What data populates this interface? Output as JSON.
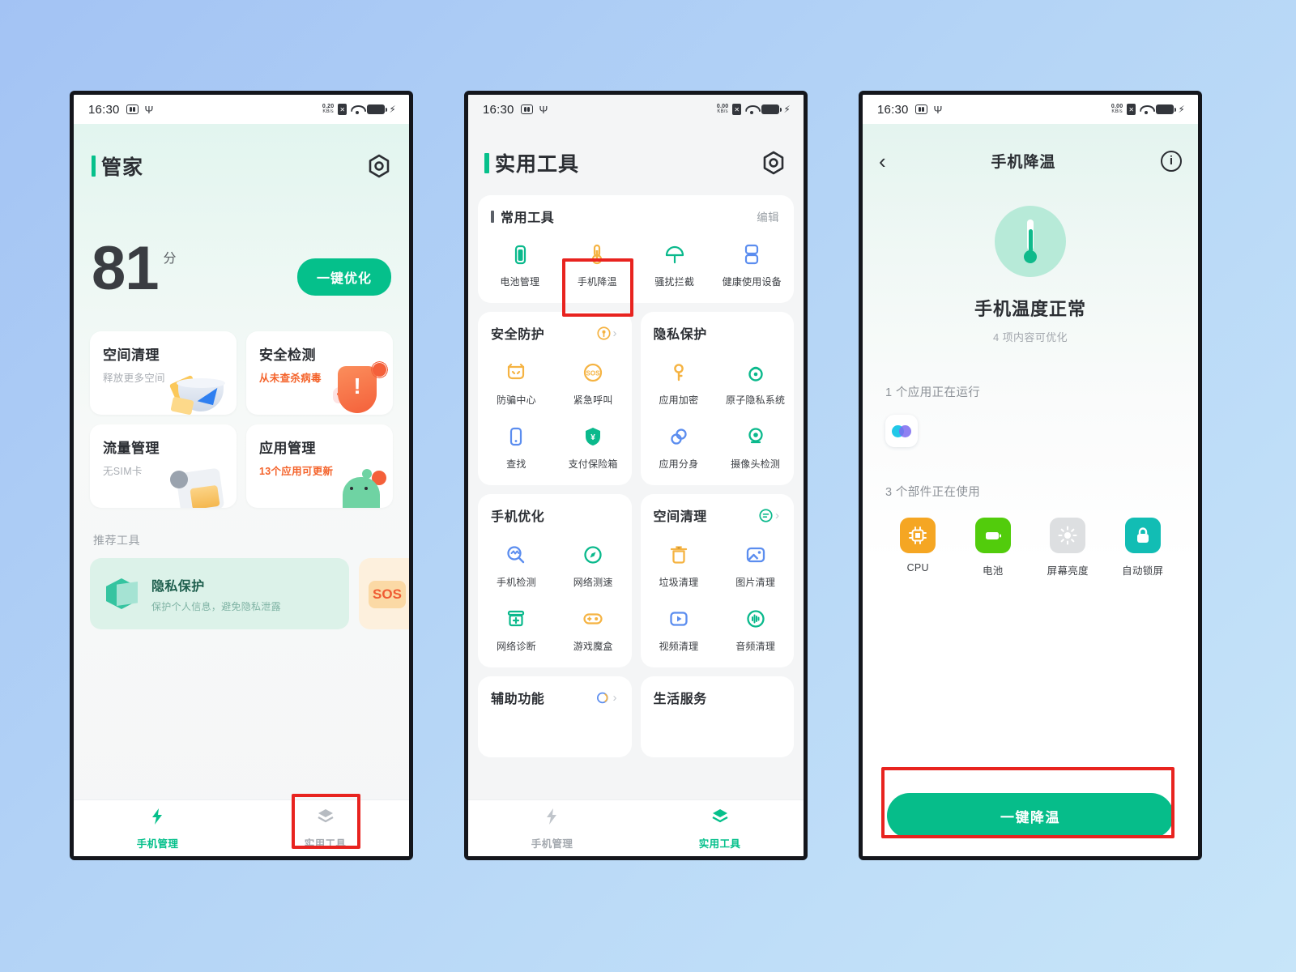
{
  "statusbar": {
    "time": "16:30",
    "net_rate_1": "0.20",
    "net_rate_2": "0.00",
    "net_unit": "KB/s",
    "sim_glyph": "✕"
  },
  "phone1": {
    "app_title": "管家",
    "gear_icon": "settings-gear-icon",
    "score": "81",
    "score_unit": "分",
    "optimize_button": "一键优化",
    "cards": [
      {
        "title": "空间清理",
        "sub": "释放更多空间",
        "warn": false
      },
      {
        "title": "安全检测",
        "sub": "从未查杀病毒",
        "warn": true
      },
      {
        "title": "流量管理",
        "sub": "无SIM卡",
        "warn": false
      },
      {
        "title": "应用管理",
        "sub": "13个应用可更新",
        "warn": true
      }
    ],
    "recommend_label": "推荐工具",
    "recommend_card": {
      "title": "隐私保护",
      "sub": "保护个人信息，避免隐私泄露"
    },
    "recommend_card2": {
      "label": "SOS"
    },
    "nav": [
      {
        "label": "手机管理",
        "active": true,
        "icon": "bolt-icon"
      },
      {
        "label": "实用工具",
        "active": false,
        "icon": "layers-icon"
      }
    ]
  },
  "phone2": {
    "app_title": "实用工具",
    "gear_icon": "settings-gear-icon",
    "common_tools": {
      "title": "常用工具",
      "edit": "编辑",
      "items": [
        {
          "label": "电池管理",
          "icon": "battery-icon",
          "color": "#0ab98c"
        },
        {
          "label": "手机降温",
          "icon": "thermometer-icon",
          "color": "#f5b342",
          "highlighted": true
        },
        {
          "label": "骚扰拦截",
          "icon": "umbrella-icon",
          "color": "#0ab98c"
        },
        {
          "label": "健康使用设备",
          "icon": "hourglass-icon",
          "color": "#5b8def"
        }
      ]
    },
    "sections": [
      {
        "title": "安全防护",
        "header_icon": "shield-person-icon",
        "header_icon_color": "#f5b342",
        "has_arrow": true,
        "items": [
          {
            "label": "防骗中心",
            "icon": "mask-icon",
            "color": "#f5b342"
          },
          {
            "label": "紧急呼叫",
            "icon": "sos-circle-icon",
            "color": "#f5b342"
          },
          {
            "label": "查找",
            "icon": "phone-find-icon",
            "color": "#5b8def"
          },
          {
            "label": "支付保险箱",
            "icon": "shield-yuan-icon",
            "color": "#0ab98c"
          }
        ]
      },
      {
        "title": "隐私保护",
        "header_icon": "",
        "header_icon_color": "",
        "has_arrow": false,
        "items": [
          {
            "label": "应用加密",
            "icon": "key-icon",
            "color": "#f5b342"
          },
          {
            "label": "原子隐私系统",
            "icon": "atom-lock-icon",
            "color": "#0ab98c"
          },
          {
            "label": "应用分身",
            "icon": "link-rings-icon",
            "color": "#5b8def"
          },
          {
            "label": "摄像头检测",
            "icon": "camera-detect-icon",
            "color": "#0ab98c"
          }
        ]
      },
      {
        "title": "手机优化",
        "header_icon": "",
        "header_icon_color": "",
        "has_arrow": false,
        "items": [
          {
            "label": "手机检测",
            "icon": "magnifier-pulse-icon",
            "color": "#5b8def"
          },
          {
            "label": "网络测速",
            "icon": "compass-icon",
            "color": "#0ab98c"
          },
          {
            "label": "网络诊断",
            "icon": "network-diag-icon",
            "color": "#0ab98c"
          },
          {
            "label": "游戏魔盒",
            "icon": "gamepad-icon",
            "color": "#f5b342"
          }
        ]
      },
      {
        "title": "空间清理",
        "header_icon": "chat-clean-icon",
        "header_icon_color": "#0ab98c",
        "has_arrow": true,
        "items": [
          {
            "label": "垃圾清理",
            "icon": "trash-icon",
            "color": "#f5b342"
          },
          {
            "label": "图片清理",
            "icon": "image-icon",
            "color": "#5b8def"
          },
          {
            "label": "视频清理",
            "icon": "video-play-icon",
            "color": "#5b8def"
          },
          {
            "label": "音频清理",
            "icon": "audio-wave-icon",
            "color": "#0ab98c"
          }
        ]
      },
      {
        "title": "辅助功能",
        "header_icon": "call-assist-icon",
        "header_icon_color": "#5b8def",
        "has_arrow": true,
        "items": []
      },
      {
        "title": "生活服务",
        "header_icon": "",
        "header_icon_color": "",
        "has_arrow": false,
        "items": []
      }
    ],
    "nav": [
      {
        "label": "手机管理",
        "active": false,
        "icon": "bolt-icon"
      },
      {
        "label": "实用工具",
        "active": true,
        "icon": "layers-icon"
      }
    ]
  },
  "phone3": {
    "back_icon": "chevron-left-icon",
    "title": "手机降温",
    "info_icon": "info-circle-icon",
    "hero_icon": "thermometer-icon",
    "status_text": "手机温度正常",
    "status_sub": "4 项内容可优化",
    "running_apps_label": "1 个应用正在运行",
    "running_apps": [
      {
        "icon": "venn-app-icon"
      }
    ],
    "components_label": "3 个部件正在使用",
    "components": [
      {
        "label": "CPU",
        "icon": "cpu-icon",
        "color": "#f5a623"
      },
      {
        "label": "电池",
        "icon": "battery-icon",
        "color": "#52cc0c"
      },
      {
        "label": "屏幕亮度",
        "icon": "brightness-icon",
        "color": "#dddfe1"
      },
      {
        "label": "自动锁屏",
        "icon": "lock-icon",
        "color": "#12bdb4"
      }
    ],
    "cool_button": "一键降温"
  },
  "colors": {
    "accent_green": "#05c08b",
    "warn_orange": "#f4632b",
    "highlight_red": "#e8231f",
    "page_bg_start": "#a3c3f4",
    "page_bg_end": "#c7e5f9"
  }
}
